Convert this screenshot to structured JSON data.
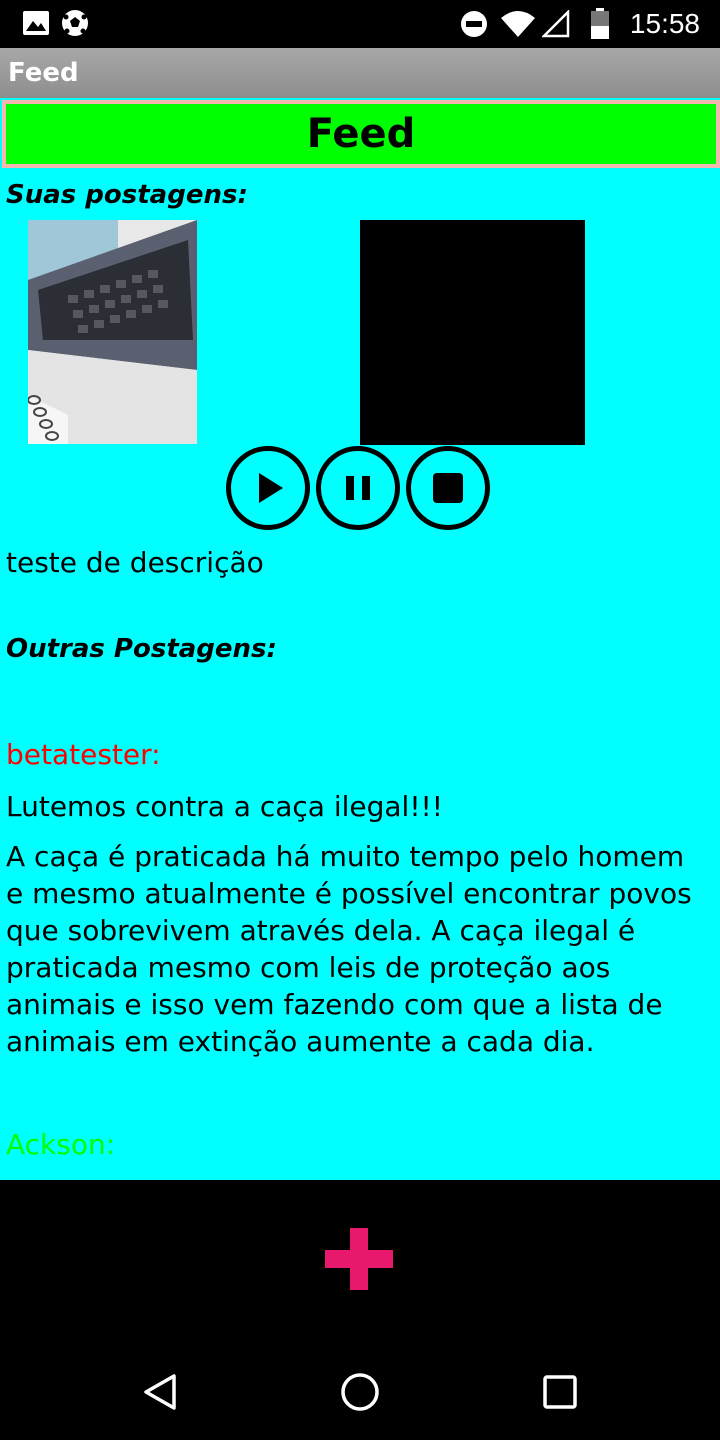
{
  "status_bar": {
    "time": "15:58",
    "icons": [
      "image-icon",
      "soccer-ball-icon",
      "do-not-disturb-icon",
      "wifi-icon",
      "signal-icon",
      "battery-icon"
    ]
  },
  "action_bar": {
    "title": "Feed"
  },
  "banner": {
    "label": "Feed",
    "color": "#00ff00"
  },
  "my_posts": {
    "heading": "Suas postagens:",
    "description": "teste de descrição",
    "media_controls": [
      "play-icon",
      "pause-icon",
      "stop-icon"
    ]
  },
  "other_posts": {
    "heading": "Outras Postagens:",
    "posts": [
      {
        "author": "betatester:",
        "author_color": "#ff0000",
        "title": "Lutemos contra a caça ilegal!!!",
        "body": "A caça é praticada há muito tempo pelo homem e mesmo atualmente é possível encontrar povos que sobrevivem através dela. A caça ilegal é praticada mesmo com leis de proteção aos animais e isso vem fazendo com que a lista de animais em extinção aumente a cada dia."
      },
      {
        "author": "Ackson:",
        "author_color": "#00ff00"
      }
    ]
  },
  "fab": {
    "icon": "plus-icon",
    "color": "#e8186c"
  },
  "nav_bar": {
    "icons": [
      "back-icon",
      "home-icon",
      "recents-icon"
    ]
  },
  "colors": {
    "content_bg": "#00ffff",
    "bar_bg": "#000000"
  }
}
